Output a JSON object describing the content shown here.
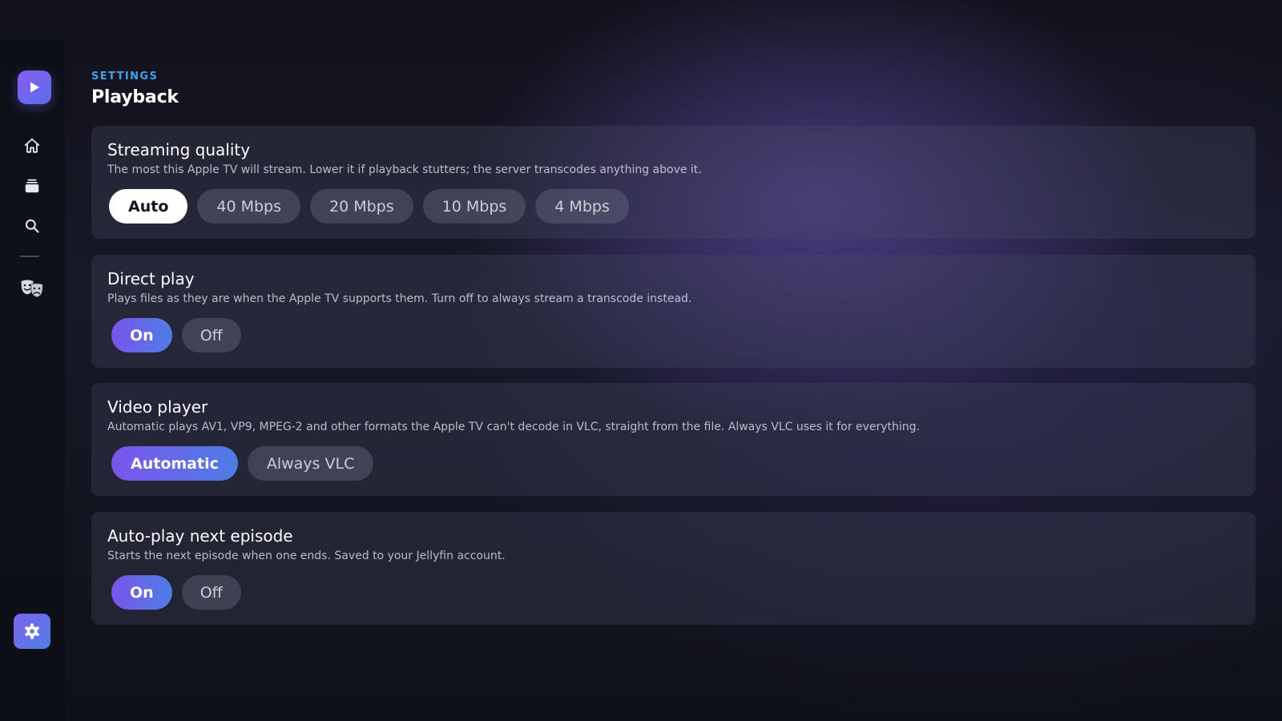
{
  "sidebar": {
    "logo_icon": "play-icon",
    "items": [
      {
        "icon": "home-icon"
      },
      {
        "icon": "library-icon"
      },
      {
        "icon": "search-icon"
      },
      {
        "icon": "theater-masks-icon"
      }
    ],
    "settings_icon": "gear-icon"
  },
  "header": {
    "eyebrow": "SETTINGS",
    "title": "Playback"
  },
  "sections": [
    {
      "title": "Streaming quality",
      "description": "The most this Apple TV will stream. Lower it if playback stutters; the server transcodes anything above it.",
      "options": [
        "Auto",
        "40 Mbps",
        "20 Mbps",
        "10 Mbps",
        "4 Mbps"
      ],
      "selected": "Auto"
    },
    {
      "title": "Direct play",
      "description": "Plays files as they are when the Apple TV supports them. Turn off to always stream a transcode instead.",
      "options": [
        "On",
        "Off"
      ],
      "selected": "On"
    },
    {
      "title": "Video player",
      "description": "Automatic plays AV1, VP9, MPEG-2 and other formats the Apple TV can't decode in VLC, straight from the file. Always VLC uses it for everything.",
      "options": [
        "Automatic",
        "Always VLC"
      ],
      "selected": "Automatic"
    },
    {
      "title": "Auto-play next episode",
      "description": "Starts the next episode when one ends. Saved to your Jellyfin account.",
      "options": [
        "On",
        "Off"
      ],
      "selected": "On"
    }
  ],
  "colors": {
    "accent_blue": "#3fa3f0",
    "accent_gradient_start": "#7a55ec",
    "accent_gradient_end": "#4e7de6"
  }
}
